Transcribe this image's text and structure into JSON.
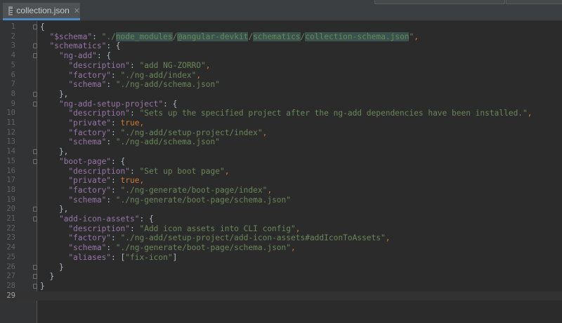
{
  "tab": {
    "filename": "collection.json",
    "close_glyph": "✕",
    "icon": "json-file-icon"
  },
  "editor": {
    "current_line": 29,
    "lines": [
      [
        {
          "t": "{",
          "c": "p"
        }
      ],
      [
        {
          "t": "  ",
          "c": "p"
        },
        {
          "t": "\"$schema\"",
          "c": "k"
        },
        {
          "t": ": ",
          "c": "p"
        },
        {
          "t": "\"./",
          "c": "s"
        },
        {
          "t": "node_modules",
          "c": "s hl"
        },
        {
          "t": "/",
          "c": "s"
        },
        {
          "t": "@angular-devkit",
          "c": "s hl"
        },
        {
          "t": "/",
          "c": "s"
        },
        {
          "t": "schematics",
          "c": "s hl"
        },
        {
          "t": "/",
          "c": "s"
        },
        {
          "t": "collection-schema.json",
          "c": "s hl"
        },
        {
          "t": "\"",
          "c": "s"
        },
        {
          "t": ",",
          "c": "b"
        }
      ],
      [
        {
          "t": "  ",
          "c": "p"
        },
        {
          "t": "\"schematics\"",
          "c": "k"
        },
        {
          "t": ": {",
          "c": "p"
        }
      ],
      [
        {
          "t": "    ",
          "c": "p"
        },
        {
          "t": "\"ng-add\"",
          "c": "k"
        },
        {
          "t": ": {",
          "c": "p"
        }
      ],
      [
        {
          "t": "      ",
          "c": "p"
        },
        {
          "t": "\"description\"",
          "c": "k"
        },
        {
          "t": ": ",
          "c": "p"
        },
        {
          "t": "\"add NG-ZORRO\"",
          "c": "s"
        },
        {
          "t": ",",
          "c": "b"
        }
      ],
      [
        {
          "t": "      ",
          "c": "p"
        },
        {
          "t": "\"factory\"",
          "c": "k"
        },
        {
          "t": ": ",
          "c": "p"
        },
        {
          "t": "\"./ng-add/index\"",
          "c": "s"
        },
        {
          "t": ",",
          "c": "b"
        }
      ],
      [
        {
          "t": "      ",
          "c": "p"
        },
        {
          "t": "\"schema\"",
          "c": "k"
        },
        {
          "t": ": ",
          "c": "p"
        },
        {
          "t": "\"./ng-add/schema.json\"",
          "c": "s"
        }
      ],
      [
        {
          "t": "    },",
          "c": "p"
        }
      ],
      [
        {
          "t": "    ",
          "c": "p"
        },
        {
          "t": "\"ng-add-setup-project\"",
          "c": "k"
        },
        {
          "t": ": {",
          "c": "p"
        }
      ],
      [
        {
          "t": "      ",
          "c": "p"
        },
        {
          "t": "\"description\"",
          "c": "k"
        },
        {
          "t": ": ",
          "c": "p"
        },
        {
          "t": "\"Sets up the specified project after the ng-add dependencies have been installed.\"",
          "c": "s"
        },
        {
          "t": ",",
          "c": "b"
        }
      ],
      [
        {
          "t": "      ",
          "c": "p"
        },
        {
          "t": "\"private\"",
          "c": "k"
        },
        {
          "t": ": ",
          "c": "p"
        },
        {
          "t": "true",
          "c": "b"
        },
        {
          "t": ",",
          "c": "b"
        }
      ],
      [
        {
          "t": "      ",
          "c": "p"
        },
        {
          "t": "\"factory\"",
          "c": "k"
        },
        {
          "t": ": ",
          "c": "p"
        },
        {
          "t": "\"./ng-add/setup-project/index\"",
          "c": "s"
        },
        {
          "t": ",",
          "c": "b"
        }
      ],
      [
        {
          "t": "      ",
          "c": "p"
        },
        {
          "t": "\"schema\"",
          "c": "k"
        },
        {
          "t": ": ",
          "c": "p"
        },
        {
          "t": "\"./ng-add/schema.json\"",
          "c": "s"
        }
      ],
      [
        {
          "t": "    },",
          "c": "p"
        }
      ],
      [
        {
          "t": "    ",
          "c": "p"
        },
        {
          "t": "\"boot-page\"",
          "c": "k"
        },
        {
          "t": ": {",
          "c": "p"
        }
      ],
      [
        {
          "t": "      ",
          "c": "p"
        },
        {
          "t": "\"description\"",
          "c": "k"
        },
        {
          "t": ": ",
          "c": "p"
        },
        {
          "t": "\"Set up boot page\"",
          "c": "s"
        },
        {
          "t": ",",
          "c": "b"
        }
      ],
      [
        {
          "t": "      ",
          "c": "p"
        },
        {
          "t": "\"private\"",
          "c": "k"
        },
        {
          "t": ": ",
          "c": "p"
        },
        {
          "t": "true",
          "c": "b"
        },
        {
          "t": ",",
          "c": "b"
        }
      ],
      [
        {
          "t": "      ",
          "c": "p"
        },
        {
          "t": "\"factory\"",
          "c": "k"
        },
        {
          "t": ": ",
          "c": "p"
        },
        {
          "t": "\"./ng-generate/boot-page/index\"",
          "c": "s"
        },
        {
          "t": ",",
          "c": "b"
        }
      ],
      [
        {
          "t": "      ",
          "c": "p"
        },
        {
          "t": "\"schema\"",
          "c": "k"
        },
        {
          "t": ": ",
          "c": "p"
        },
        {
          "t": "\"./ng-generate/boot-page/schema.json\"",
          "c": "s"
        }
      ],
      [
        {
          "t": "    },",
          "c": "p"
        }
      ],
      [
        {
          "t": "    ",
          "c": "p"
        },
        {
          "t": "\"add-icon-assets\"",
          "c": "k"
        },
        {
          "t": ": {",
          "c": "p"
        }
      ],
      [
        {
          "t": "      ",
          "c": "p"
        },
        {
          "t": "\"description\"",
          "c": "k"
        },
        {
          "t": ": ",
          "c": "p"
        },
        {
          "t": "\"Add icon assets into CLI config\"",
          "c": "s"
        },
        {
          "t": ",",
          "c": "b"
        }
      ],
      [
        {
          "t": "      ",
          "c": "p"
        },
        {
          "t": "\"factory\"",
          "c": "k"
        },
        {
          "t": ": ",
          "c": "p"
        },
        {
          "t": "\"./ng-add/setup-project/add-icon-assets#addIconToAssets\"",
          "c": "s"
        },
        {
          "t": ",",
          "c": "b"
        }
      ],
      [
        {
          "t": "      ",
          "c": "p"
        },
        {
          "t": "\"schema\"",
          "c": "k"
        },
        {
          "t": ": ",
          "c": "p"
        },
        {
          "t": "\"./ng-generate/boot-page/schema.json\"",
          "c": "s"
        },
        {
          "t": ",",
          "c": "b"
        }
      ],
      [
        {
          "t": "      ",
          "c": "p"
        },
        {
          "t": "\"aliases\"",
          "c": "k"
        },
        {
          "t": ": [",
          "c": "p"
        },
        {
          "t": "\"fix-icon\"",
          "c": "s"
        },
        {
          "t": "]",
          "c": "p"
        }
      ],
      [
        {
          "t": "    }",
          "c": "p"
        }
      ],
      [
        {
          "t": "  }",
          "c": "p"
        }
      ],
      [
        {
          "t": "}",
          "c": "p"
        }
      ],
      []
    ],
    "fold_lines": [
      1,
      3,
      4,
      8,
      9,
      14,
      15,
      20,
      21,
      26,
      27,
      28
    ]
  }
}
